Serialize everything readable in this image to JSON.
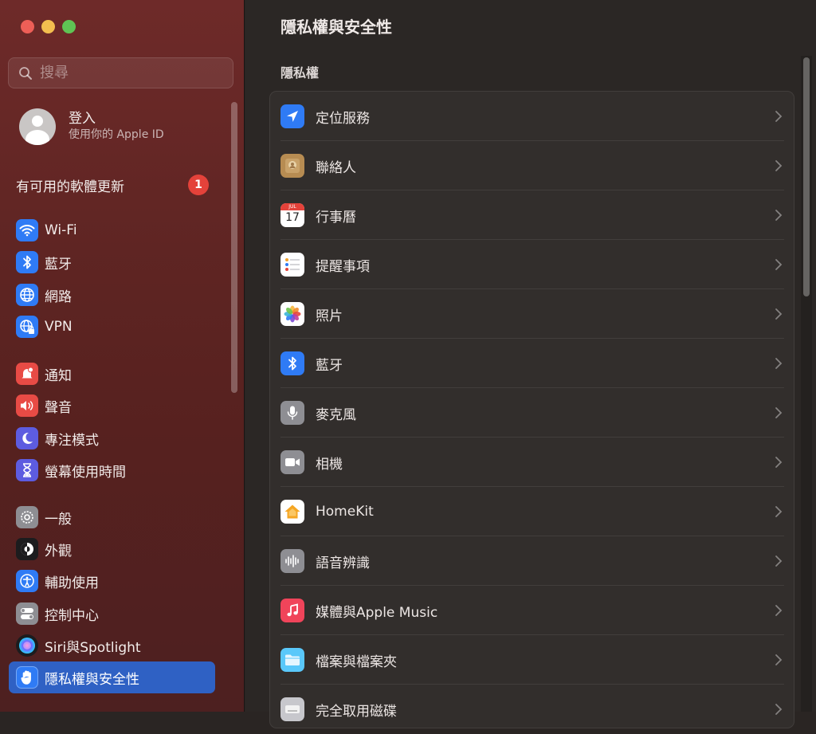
{
  "window": {
    "title": "隱私權與安全性"
  },
  "sidebar": {
    "search_placeholder": "搜尋",
    "account": {
      "title": "登入",
      "subtitle": "使用你的 Apple ID"
    },
    "update": {
      "label": "有可用的軟體更新",
      "count": "1"
    },
    "items": [
      {
        "label": "Wi-Fi",
        "icon": "wifi-icon",
        "color": "#2f7bf5"
      },
      {
        "label": "藍牙",
        "icon": "bluetooth-icon",
        "color": "#2f7bf5"
      },
      {
        "label": "網路",
        "icon": "globe-icon",
        "color": "#2f7bf5"
      },
      {
        "label": "VPN",
        "icon": "vpn-globe-icon",
        "color": "#2f7bf5"
      },
      {
        "label": "通知",
        "icon": "notification-bell-icon",
        "color": "#e84b45"
      },
      {
        "label": "聲音",
        "icon": "speaker-icon",
        "color": "#e84b45"
      },
      {
        "label": "專注模式",
        "icon": "moon-icon",
        "color": "#5d5ce0"
      },
      {
        "label": "螢幕使用時間",
        "icon": "hourglass-icon",
        "color": "#5d5ce0"
      },
      {
        "label": "一般",
        "icon": "gear-icon",
        "color": "#8e8e93"
      },
      {
        "label": "外觀",
        "icon": "appearance-icon",
        "color": "#1c1c1e"
      },
      {
        "label": "輔助使用",
        "icon": "accessibility-icon",
        "color": "#2f7bf5"
      },
      {
        "label": "控制中心",
        "icon": "control-center-icon",
        "color": "#8e8e93"
      },
      {
        "label": "Siri與Spotlight",
        "icon": "siri-icon",
        "color": "#1c1c1e"
      },
      {
        "label": "隱私權與安全性",
        "icon": "hand-icon",
        "color": "#2f7bf5",
        "selected": true
      }
    ]
  },
  "main": {
    "title": "隱私權與安全性",
    "section": "隱私權",
    "rows": [
      {
        "label": "定位服務",
        "icon": "location-arrow-icon"
      },
      {
        "label": "聯絡人",
        "icon": "contacts-icon"
      },
      {
        "label": "行事曆",
        "icon": "calendar-icon",
        "calendar_month": "JUL",
        "calendar_day": "17"
      },
      {
        "label": "提醒事項",
        "icon": "reminders-icon"
      },
      {
        "label": "照片",
        "icon": "photos-icon"
      },
      {
        "label": "藍牙",
        "icon": "bluetooth-icon"
      },
      {
        "label": "麥克風",
        "icon": "microphone-icon"
      },
      {
        "label": "相機",
        "icon": "camera-icon"
      },
      {
        "label": "HomeKit",
        "icon": "home-icon"
      },
      {
        "label": "語音辨識",
        "icon": "speech-waveform-icon"
      },
      {
        "label": "媒體與Apple Music",
        "icon": "music-note-icon"
      },
      {
        "label": "檔案與檔案夾",
        "icon": "folder-icon"
      },
      {
        "label": "完全取用磁碟",
        "icon": "disk-icon"
      }
    ]
  }
}
